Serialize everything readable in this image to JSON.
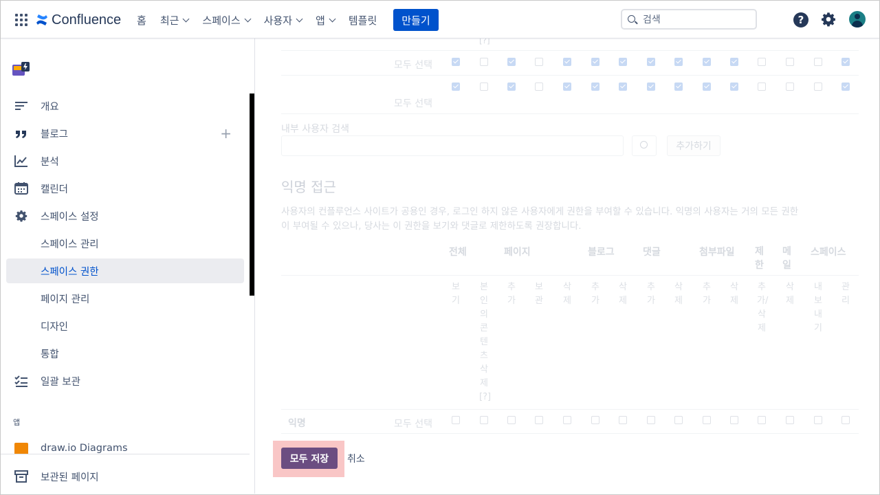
{
  "app": {
    "name": "Confluence"
  },
  "nav": {
    "items": [
      {
        "label": "홈",
        "dropdown": false
      },
      {
        "label": "최근",
        "dropdown": true
      },
      {
        "label": "스페이스",
        "dropdown": true
      },
      {
        "label": "사용자",
        "dropdown": true
      },
      {
        "label": "앱",
        "dropdown": true
      },
      {
        "label": "템플릿",
        "dropdown": false
      }
    ],
    "create_label": "만들기"
  },
  "search": {
    "placeholder": "검색"
  },
  "header_icons": [
    "apps-grid-icon",
    "help-icon",
    "settings-gear-icon",
    "user-avatar"
  ],
  "sidebar": {
    "items": [
      {
        "label": "개요",
        "icon": "overview-lines-icon"
      },
      {
        "label": "블로그",
        "icon": "quote-icon"
      },
      {
        "label": "분석",
        "icon": "analytics-chart-icon"
      },
      {
        "label": "캘린더",
        "icon": "calendar-icon"
      },
      {
        "label": "스페이스 설정",
        "icon": "gear-icon"
      },
      {
        "label": "스페이스 관리"
      },
      {
        "label": "스페이스 권한"
      },
      {
        "label": "페이지 관리"
      },
      {
        "label": "디자인"
      },
      {
        "label": "통합"
      },
      {
        "label": "일괄 보관",
        "icon": "bulk-archive-icon"
      }
    ],
    "apps_section_label": "앱",
    "app_item": "draw.io Diagrams",
    "footer_label": "보관된 페이지"
  },
  "permissions": {
    "top_fragment": "[?]",
    "select_all_label": "모두 선택",
    "internal_user_search_label": "내부 사용자 검색",
    "add_button": "추가하기",
    "anonymous_title": "익명 접근",
    "anonymous_desc_line1": "사용자의 컨플루언스 사이트가 공용인 경우, 로그인 하지 않은 사용자에게 권한을 부여할 수 있습니다. 익명의 사용자는 거의 모든 권한",
    "anonymous_desc_line2": "이 부여될 수 있으나, 당사는 이 권한을 보기와 댓글로 제한하도록 권장합니다.",
    "groups": [
      "전체",
      "페이지",
      "블로그",
      "댓글",
      "첨부파일",
      "제한",
      "메일",
      "스페이스"
    ],
    "columns": [
      "보기",
      "본인의콘텐츠삭제[?]",
      "추가",
      "보관",
      "삭제",
      "추가",
      "삭제",
      "추가",
      "삭제",
      "추가",
      "삭제",
      "추가/삭제",
      "삭제",
      "내보내기",
      "관리"
    ],
    "rows": [
      {
        "label": "",
        "checked": [
          1,
          0,
          1,
          0,
          1,
          1,
          1,
          1,
          1,
          1,
          1,
          0,
          0,
          0,
          1
        ]
      },
      {
        "label": "",
        "checked": [
          1,
          0,
          1,
          0,
          1,
          1,
          1,
          1,
          1,
          1,
          1,
          0,
          0,
          0,
          1
        ]
      },
      {
        "label": "익명",
        "checked": [
          0,
          0,
          0,
          0,
          0,
          0,
          0,
          0,
          0,
          0,
          0,
          0,
          0,
          0,
          0
        ]
      }
    ]
  },
  "actions": {
    "save_all": "모두 저장",
    "cancel": "취소"
  }
}
